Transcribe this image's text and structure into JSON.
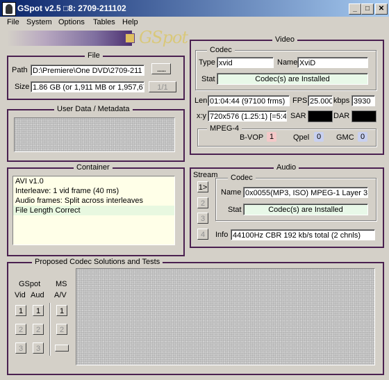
{
  "window": {
    "title": "GSpot v2.5  □8: 2709-211102"
  },
  "menu": {
    "file": "File",
    "system": "System",
    "options": "Options",
    "tables": "Tables",
    "help": "Help"
  },
  "logo": "GSpot",
  "file": {
    "label": "File",
    "path_label": "Path",
    "path_value": "D:\\Premiere\\One DVD\\2709-211",
    "size_label": "Size",
    "size_value": "1.86 GB (or 1,911 MB or 1,957,67",
    "page": "1/1"
  },
  "metadata": {
    "label": "User Data / Metadata"
  },
  "container": {
    "label": "Container",
    "lines": [
      "AVI v1.0",
      "Interleave: 1 vid frame (40 ms)",
      "Audio frames: Split across interleaves",
      "File Length Correct"
    ]
  },
  "video": {
    "label": "Video",
    "codec_label": "Codec",
    "type_label": "Type",
    "type_value": "xvid",
    "name_label": "Name",
    "name_value": "XviD",
    "stat_label": "Stat",
    "stat_value": "Codec(s) are Installed",
    "len_label": "Len",
    "len_value": "01:04:44 (97100 frms)",
    "fps_label": "FPS",
    "fps_value": "25.000",
    "kbps_label": "kbps",
    "kbps_value": "3930",
    "xy_label": "x:y",
    "xy_value": "720x576 (1.25:1) [=5:4]",
    "sar_label": "SAR",
    "dar_label": "DAR",
    "mpeg4_label": "MPEG-4",
    "bvop_label": "B-VOP",
    "bvop_value": "1",
    "qpel_label": "Qpel",
    "qpel_value": "0",
    "gmc_label": "GMC",
    "gmc_value": "0"
  },
  "audio": {
    "label": "Audio",
    "stream_label": "Stream",
    "streams": [
      "1>",
      "2",
      "3",
      "4"
    ],
    "codec_label": "Codec",
    "name_label": "Name",
    "name_value": "0x0055(MP3, ISO) MPEG-1 Layer 3",
    "stat_label": "Stat",
    "stat_value": "Codec(s) are Installed",
    "info_label": "Info",
    "info_value": "44100Hz  CBR 192 kb/s total (2 chnls)"
  },
  "proposed": {
    "label": "Proposed Codec Solutions and Tests",
    "gspot_label": "GSpot",
    "vid_label": "Vid",
    "aud_label": "Aud",
    "ms_label": "MS",
    "av_label": "A/V",
    "b1": "1",
    "b2": "2",
    "b3": "3"
  }
}
